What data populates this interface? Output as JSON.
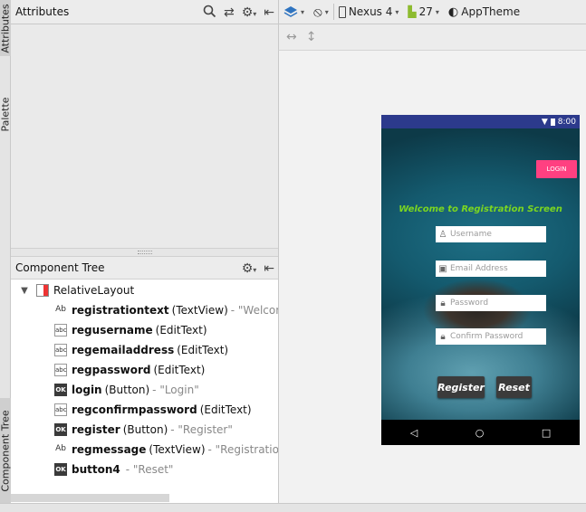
{
  "attributes_panel": {
    "title": "Attributes"
  },
  "side_tabs": {
    "attributes": "Attributes",
    "palette": "Palette",
    "component_tree": "Component Tree"
  },
  "component_tree": {
    "title": "Component Tree",
    "root": {
      "label": "RelativeLayout"
    },
    "items": [
      {
        "id": "registrationtext",
        "type": "(TextView)",
        "text": "- \"Welcome to",
        "badge": "Ab"
      },
      {
        "id": "regusername",
        "type": "(EditText)",
        "text": "",
        "badge": "abc"
      },
      {
        "id": "regemailaddress",
        "type": "(EditText)",
        "text": "",
        "badge": "abc"
      },
      {
        "id": "regpassword",
        "type": "(EditText)",
        "text": "",
        "badge": "abc"
      },
      {
        "id": "login",
        "type": "(Button)",
        "text": "- \"Login\"",
        "badge": "OK"
      },
      {
        "id": "regconfirmpassword",
        "type": "(EditText)",
        "text": "",
        "badge": "abc"
      },
      {
        "id": "register",
        "type": "(Button)",
        "text": "- \"Register\"",
        "badge": "OK"
      },
      {
        "id": "regmessage",
        "type": "(TextView)",
        "text": "- \"Registration Suc",
        "badge": "Ab"
      },
      {
        "id": "button4",
        "type": "",
        "text": "- \"Reset\"",
        "badge": "OK"
      }
    ]
  },
  "design_toolbar": {
    "device": "Nexus 4",
    "api": "27",
    "theme": "AppTheme"
  },
  "phone": {
    "status_time": "8:00",
    "login_button": "LOGIN",
    "welcome_text": "Welcome to Registration Screen",
    "fields": {
      "username": "Username",
      "email": "Email Address",
      "password": "Password",
      "confirm_password": "Confirm Password"
    },
    "register_button": "Register",
    "reset_button": "Reset",
    "nav": {
      "back": "◁",
      "home": "○",
      "recents": "□"
    }
  },
  "colors": {
    "status_bar": "#2c3a8c",
    "login_button": "#ff4081",
    "welcome_text": "#7bd620"
  }
}
